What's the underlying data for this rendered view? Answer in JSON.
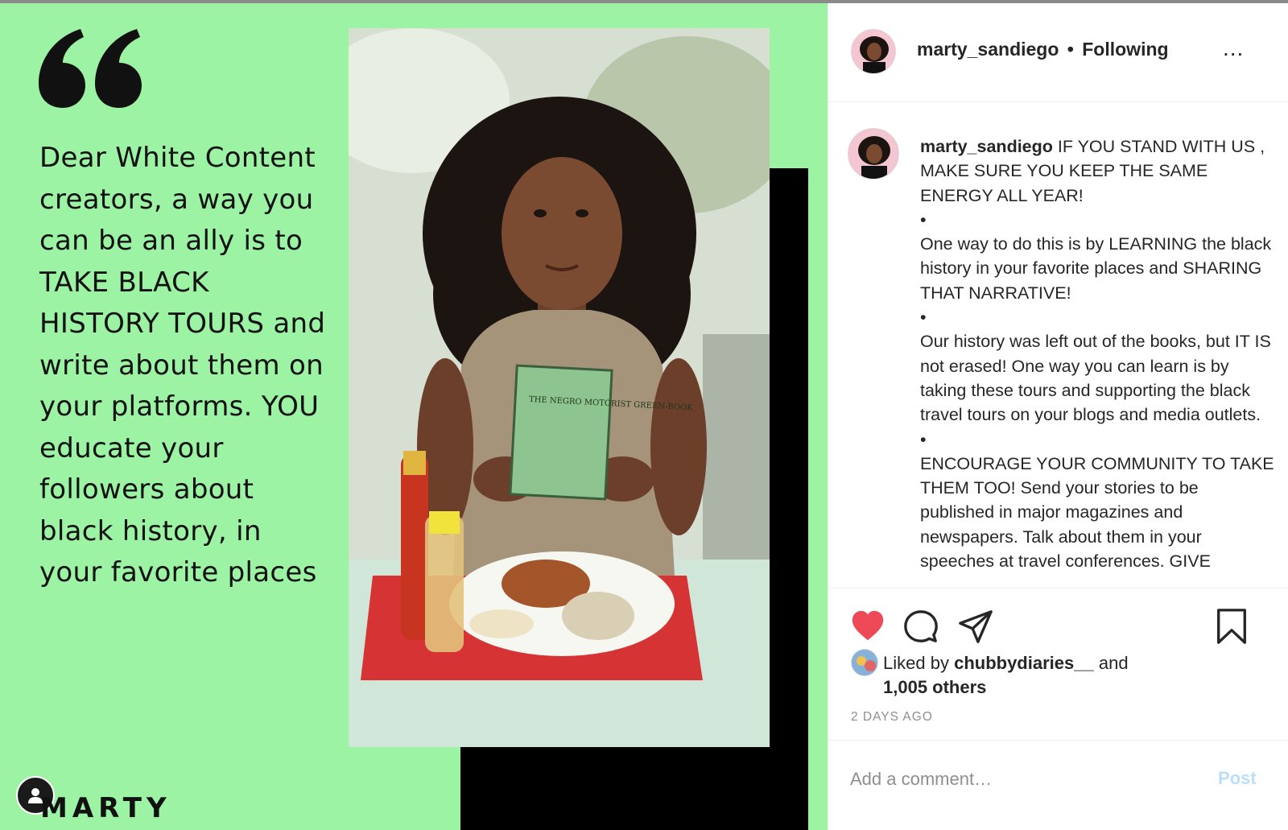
{
  "post_media": {
    "quote_text": "Dear White Content creators, a way you can be an ally is to TAKE BLACK HISTORY TOURS and write about them on your platforms. YOU educate your followers about black history, in your favorite places",
    "signature": "MARTY",
    "book_title": "THE NEGRO MOTORIST GREEN-BOOK",
    "colors": {
      "background": "#9bf3a3",
      "accent_block": "#000000"
    }
  },
  "header": {
    "username": "marty_sandiego",
    "separator": "•",
    "follow_status": "Following",
    "more_label": "..."
  },
  "caption": {
    "username": "marty_sandiego",
    "paragraphs": [
      "IF YOU STAND WITH US , MAKE SURE YOU KEEP THE SAME ENERGY ALL YEAR!",
      "•",
      "One way to do this is by LEARNING the black history in your favorite places and SHARING THAT NARRATIVE!",
      "•",
      "Our history was left out of the books, but IT IS not erased! One way you can learn is by taking these tours and supporting the black travel tours on your blogs and media outlets.",
      "•",
      "ENCOURAGE YOUR COMMUNITY TO TAKE THEM TOO! Send your stories to be published in major magazines and newspapers. Talk about them in your speeches at travel conferences. GIVE"
    ]
  },
  "actions": {
    "icons": [
      "heart-icon",
      "comment-icon",
      "share-icon",
      "bookmark-icon"
    ],
    "liked": true,
    "heart_color": "#ed4956"
  },
  "likes": {
    "prefix": "Liked by",
    "user": "chubbydiaries__",
    "connector": "and",
    "others": "1,005 others"
  },
  "timestamp": "2 DAYS AGO",
  "comment": {
    "placeholder": "Add a comment…",
    "post_label": "Post",
    "post_color": "#b9dffc"
  }
}
